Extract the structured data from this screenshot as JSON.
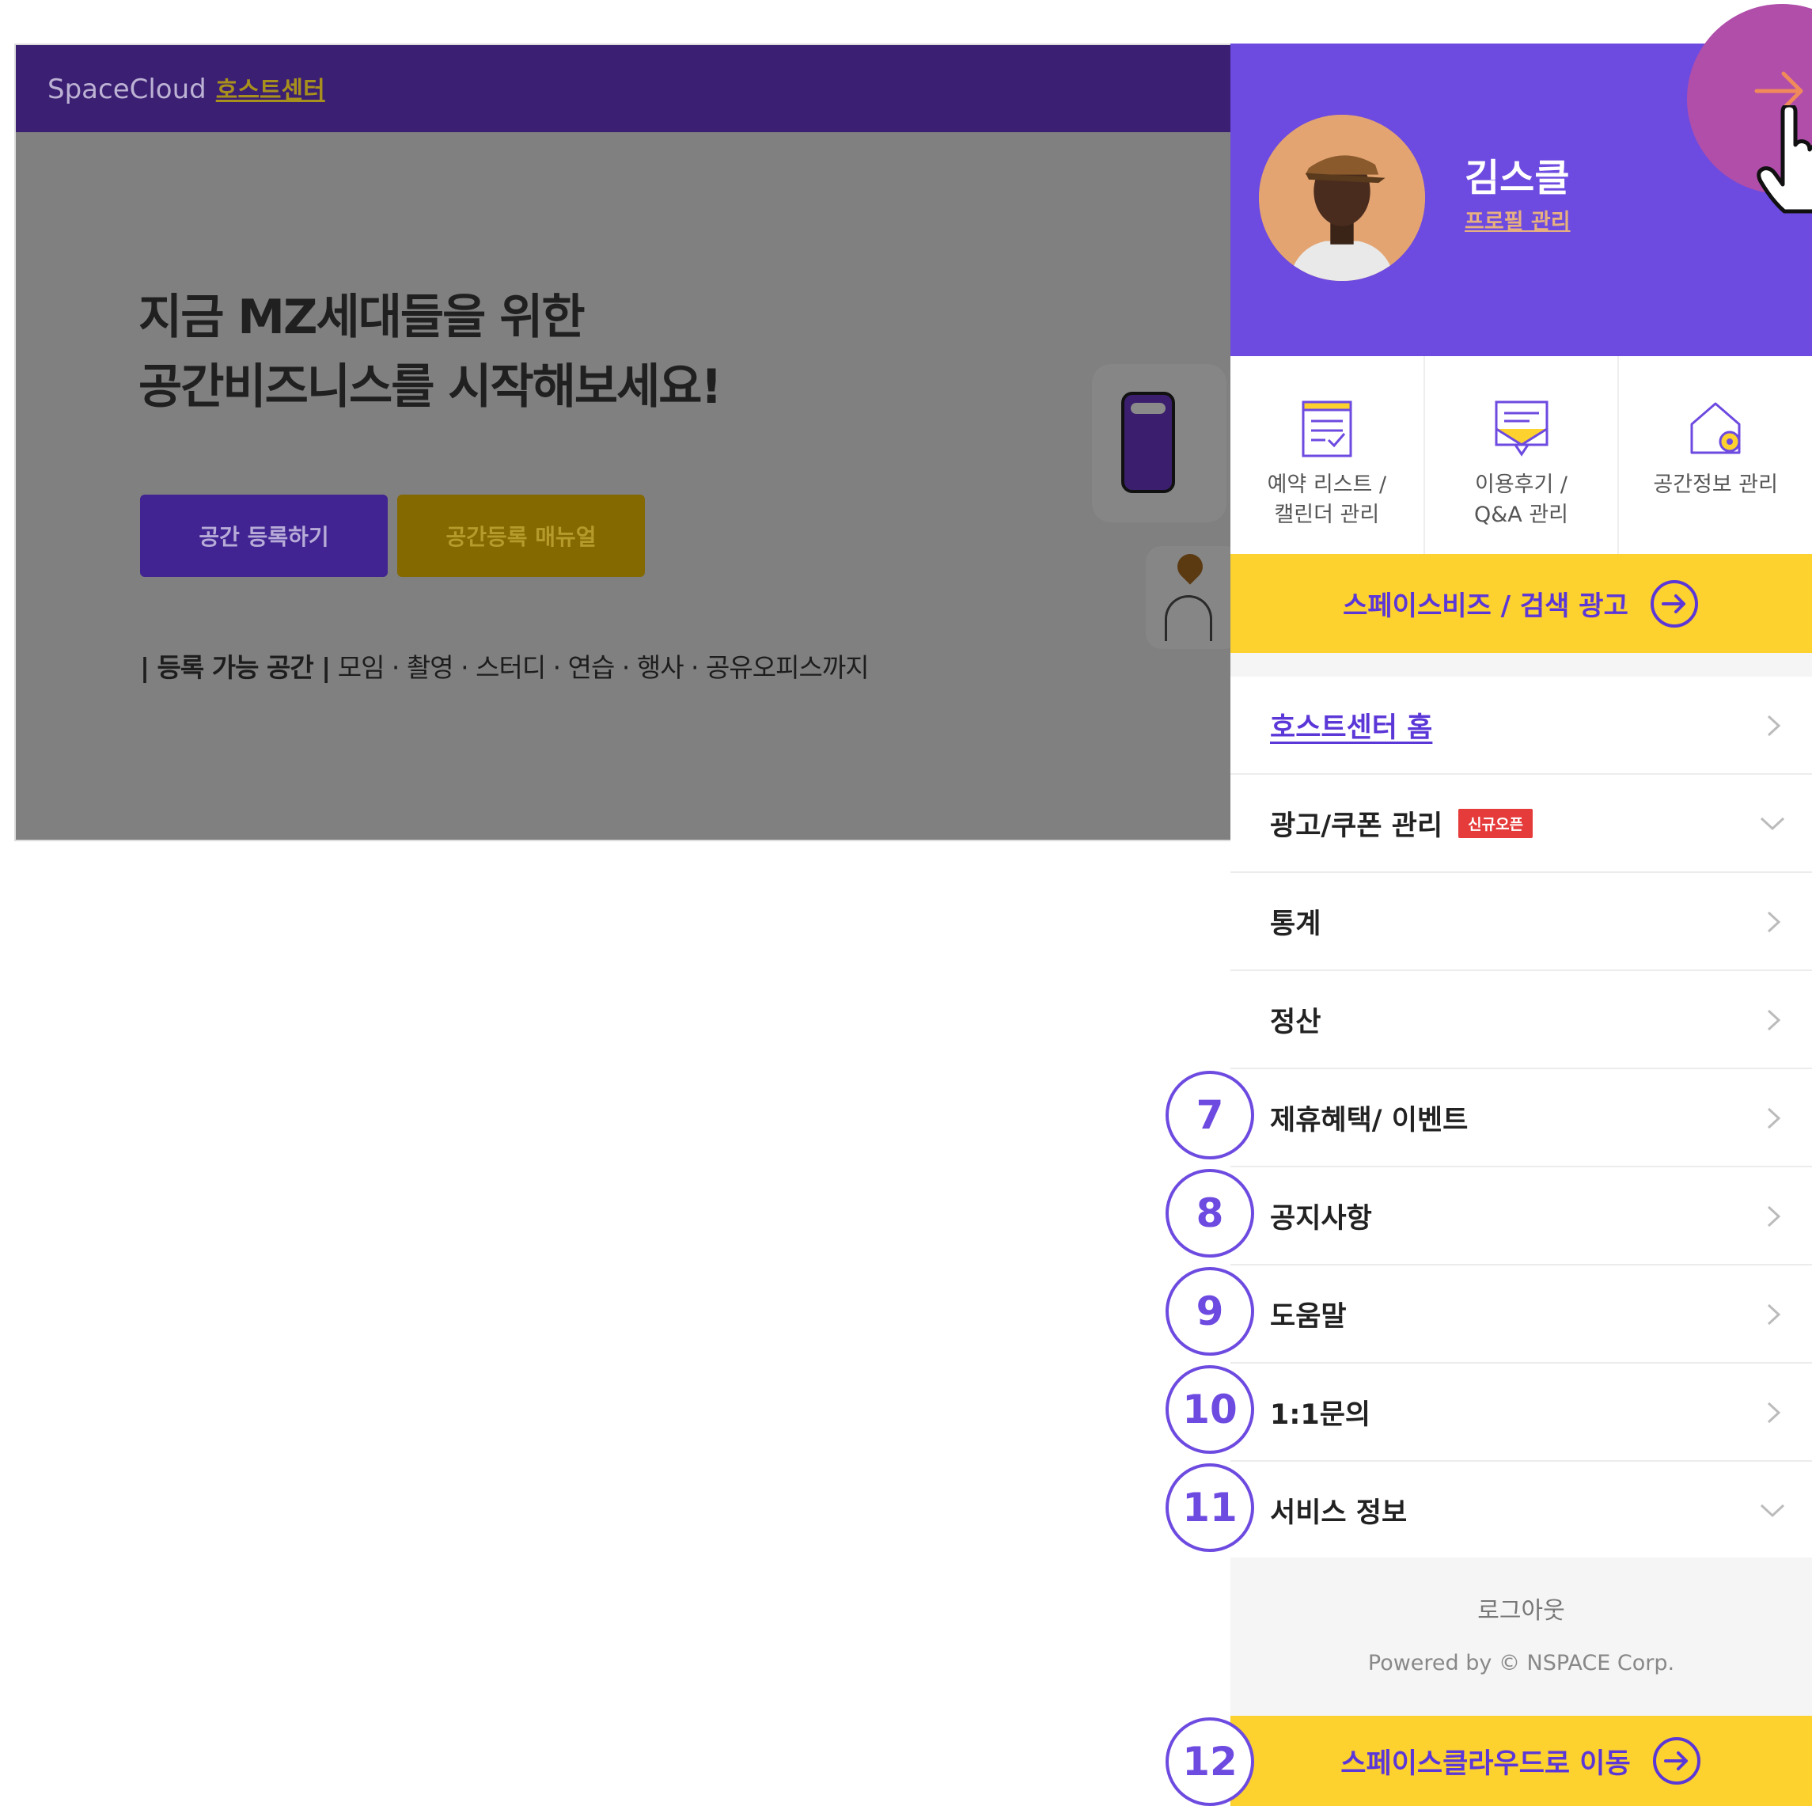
{
  "site": {
    "brand": "SpaceCloud",
    "brand_sub": "호스트센터",
    "hero_line1": "지금 MZ세대들을 위한",
    "hero_line2": "공간비즈니스를 시작해보세요!",
    "register_button": "공간 등록하기",
    "manual_button": "공간등록 매뉴얼",
    "space_types_bold": "| 등록 가능 공간 |",
    "space_types": " 모임 · 촬영 · 스터디 · 연습 · 행사 · 공유오피스까지"
  },
  "panel": {
    "user_name": "김스클",
    "profile_link": "프로필 관리",
    "quick_links": [
      {
        "label": "예약 리스트 /\n캘린더 관리",
        "icon": "calendar-list-icon"
      },
      {
        "label": "이용후기 /\nQ&A 관리",
        "icon": "review-icon"
      },
      {
        "label": "공간정보 관리",
        "icon": "house-settings-icon"
      }
    ],
    "ad_banner": "스페이스비즈 / 검색 광고",
    "menu": [
      {
        "label": "호스트센터 홈",
        "chevron": "right"
      },
      {
        "label": "광고/쿠폰 관리",
        "badge": "신규오픈",
        "chevron": "down"
      },
      {
        "label": "통계",
        "chevron": "right"
      },
      {
        "label": "정산",
        "chevron": "right"
      },
      {
        "label": "제휴혜택/ 이벤트",
        "chevron": "right"
      },
      {
        "label": "공지사항",
        "chevron": "right"
      },
      {
        "label": "도움말",
        "chevron": "right"
      },
      {
        "label": "1:1문의",
        "chevron": "right"
      },
      {
        "label": "서비스 정보",
        "chevron": "down"
      }
    ],
    "logout": "로그아웃",
    "powered_by": "Powered by © NSPACE Corp.",
    "move_banner": "스페이스클라우드로 이동"
  },
  "callouts": [
    "7",
    "8",
    "9",
    "10",
    "11",
    "12"
  ],
  "colors": {
    "brand_purple": "#6d4ae0",
    "accent_yellow": "#fdd12e",
    "badge_red": "#e53b3b",
    "overlay_gray": "#808080"
  }
}
